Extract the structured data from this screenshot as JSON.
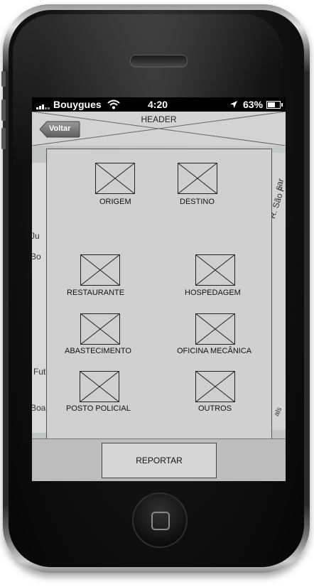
{
  "status_bar": {
    "carrier": "Bouygues",
    "time": "4:20",
    "battery_percent": "63%",
    "battery_level": 0.63,
    "wifi_icon": "wifi-icon",
    "location_icon": "location-arrow-icon"
  },
  "header": {
    "title": "HEADER",
    "back_label": "Voltar"
  },
  "map_labels": [
    "Ju",
    "Bo",
    "Fut",
    "Boa",
    "R. São F",
    "sar",
    "als"
  ],
  "menu": {
    "origem": "ORIGEM",
    "destino": "DESTINO",
    "restaurante": "RESTAURANTE",
    "hospedagem": "HOSPEDAGEM",
    "abastecimento": "ABASTECIMENTO",
    "oficina": "OFICINA MECÂNICA",
    "posto": "POSTO POLICIAL",
    "outros": "OUTROS"
  },
  "report_button": "REPORTAR"
}
